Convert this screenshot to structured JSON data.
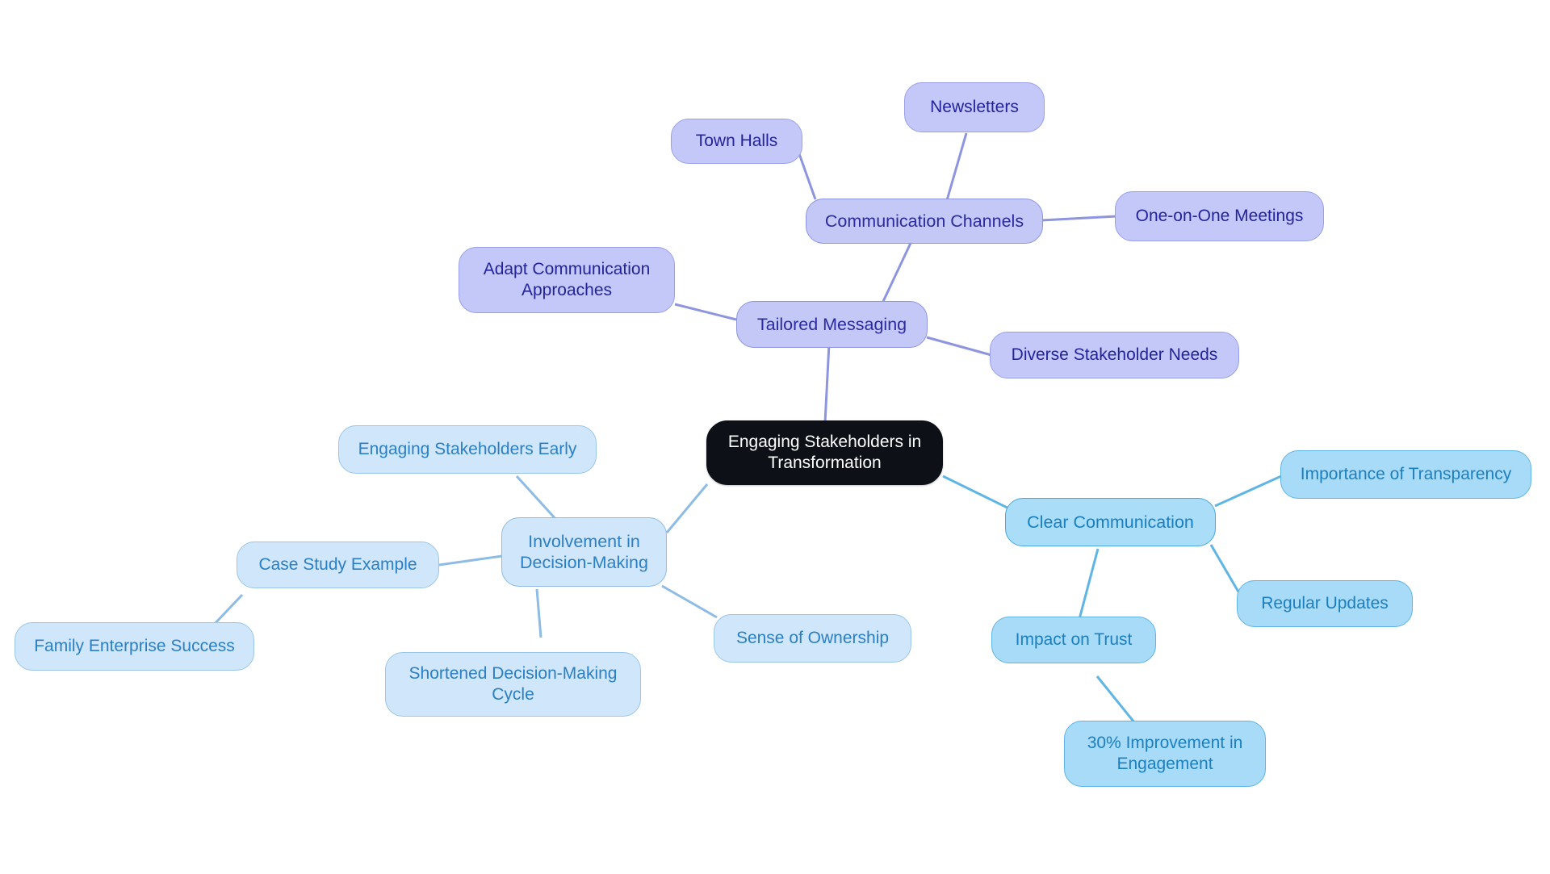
{
  "diagram": {
    "type": "mindmap",
    "title": "Engaging Stakeholders in Transformation",
    "background_color": "#ffffff",
    "palette": {
      "root_fill": "#0d1117",
      "root_text": "#ffffff",
      "purple_fill": "#c3c8f6",
      "purple_border": "#8e95e0",
      "purple_text": "#2c2a9e",
      "blue_fill": "#a9ddf8",
      "blue_border": "#49a8de",
      "blue_text": "#1a7fc1",
      "pale_fill": "#cfe6fb",
      "pale_border": "#8ebce4",
      "pale_text": "#2b7fc4",
      "edge_purple": "#8e95e0",
      "edge_blue": "#5fb5e4",
      "edge_pale": "#8ebce4"
    }
  },
  "nodes": {
    "root": {
      "label": "Engaging Stakeholders in\nTransformation"
    },
    "tailored_messaging": {
      "label": "Tailored Messaging"
    },
    "communication_channels": {
      "label": "Communication Channels"
    },
    "town_halls": {
      "label": "Town Halls"
    },
    "newsletters": {
      "label": "Newsletters"
    },
    "one_on_one_meetings": {
      "label": "One-on-One Meetings"
    },
    "adapt_communication": {
      "label": "Adapt Communication\nApproaches"
    },
    "diverse_stakeholder_needs": {
      "label": "Diverse Stakeholder Needs"
    },
    "clear_communication": {
      "label": "Clear Communication"
    },
    "importance_of_transparency": {
      "label": "Importance of Transparency"
    },
    "regular_updates": {
      "label": "Regular Updates"
    },
    "impact_on_trust": {
      "label": "Impact on Trust"
    },
    "improvement_engagement": {
      "label": "30% Improvement in\nEngagement"
    },
    "involvement_decision_making": {
      "label": "Involvement in\nDecision-Making"
    },
    "engaging_stakeholders_early": {
      "label": "Engaging Stakeholders Early"
    },
    "case_study_example": {
      "label": "Case Study Example"
    },
    "family_enterprise_success": {
      "label": "Family Enterprise Success"
    },
    "shortened_decision_cycle": {
      "label": "Shortened Decision-Making\nCycle"
    },
    "sense_of_ownership": {
      "label": "Sense of Ownership"
    }
  },
  "edges": [
    {
      "from": "root",
      "to": "tailored_messaging"
    },
    {
      "from": "tailored_messaging",
      "to": "communication_channels"
    },
    {
      "from": "communication_channels",
      "to": "town_halls"
    },
    {
      "from": "communication_channels",
      "to": "newsletters"
    },
    {
      "from": "communication_channels",
      "to": "one_on_one_meetings"
    },
    {
      "from": "tailored_messaging",
      "to": "adapt_communication"
    },
    {
      "from": "tailored_messaging",
      "to": "diverse_stakeholder_needs"
    },
    {
      "from": "root",
      "to": "clear_communication"
    },
    {
      "from": "clear_communication",
      "to": "importance_of_transparency"
    },
    {
      "from": "clear_communication",
      "to": "regular_updates"
    },
    {
      "from": "clear_communication",
      "to": "impact_on_trust"
    },
    {
      "from": "impact_on_trust",
      "to": "improvement_engagement"
    },
    {
      "from": "root",
      "to": "involvement_decision_making"
    },
    {
      "from": "involvement_decision_making",
      "to": "engaging_stakeholders_early"
    },
    {
      "from": "involvement_decision_making",
      "to": "case_study_example"
    },
    {
      "from": "case_study_example",
      "to": "family_enterprise_success"
    },
    {
      "from": "involvement_decision_making",
      "to": "shortened_decision_cycle"
    },
    {
      "from": "involvement_decision_making",
      "to": "sense_of_ownership"
    }
  ]
}
